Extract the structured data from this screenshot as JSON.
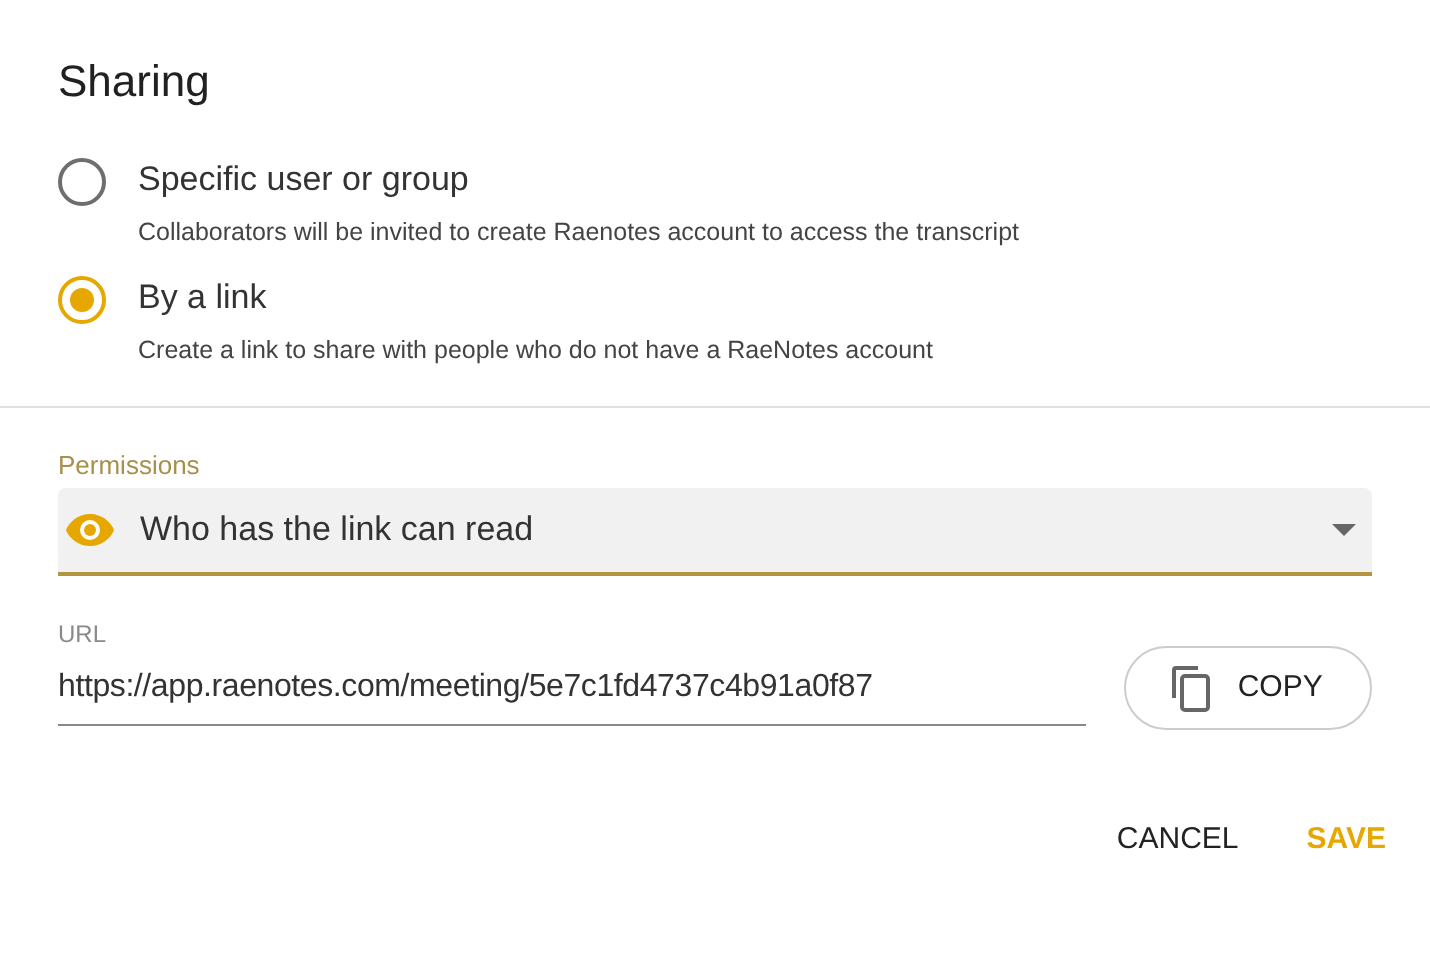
{
  "dialog": {
    "title": "Sharing"
  },
  "options": [
    {
      "label": "Specific user or group",
      "description": "Collaborators will be invited to create Raenotes account to access the transcript",
      "selected": false
    },
    {
      "label": "By a link",
      "description": "Create a link to share with people who do not have a RaeNotes account",
      "selected": true
    }
  ],
  "permissions": {
    "label": "Permissions",
    "value": "Who has the link can read"
  },
  "url": {
    "label": "URL",
    "value": "https://app.raenotes.com/meeting/5e7c1fd4737c4b91a0f87",
    "copy_button": "COPY"
  },
  "buttons": [
    {
      "label": "CANCEL",
      "kind": "secondary"
    },
    {
      "label": "SAVE",
      "kind": "primary"
    }
  ]
}
